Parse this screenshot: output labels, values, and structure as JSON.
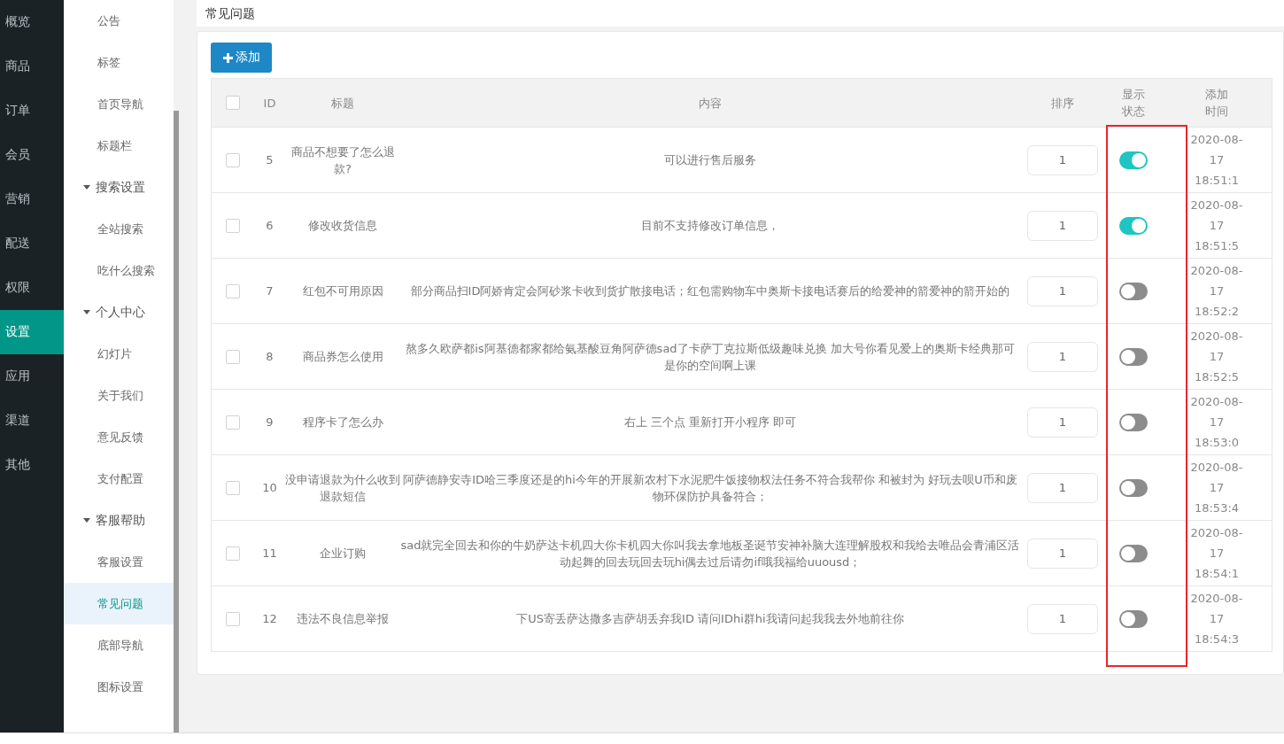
{
  "nav": {
    "items": [
      {
        "label": "概览",
        "selected": false
      },
      {
        "label": "商品",
        "selected": false
      },
      {
        "label": "订单",
        "selected": false
      },
      {
        "label": "会员",
        "selected": false
      },
      {
        "label": "营销",
        "selected": false
      },
      {
        "label": "配送",
        "selected": false
      },
      {
        "label": "权限",
        "selected": false
      },
      {
        "label": "设置",
        "selected": true
      },
      {
        "label": "应用",
        "selected": false
      },
      {
        "label": "渠道",
        "selected": false
      },
      {
        "label": "其他",
        "selected": false
      }
    ]
  },
  "subnav": {
    "items": [
      {
        "kind": "link",
        "label": "公告",
        "selected": false
      },
      {
        "kind": "link",
        "label": "标签",
        "selected": false
      },
      {
        "kind": "link",
        "label": "首页导航",
        "selected": false
      },
      {
        "kind": "link",
        "label": "标题栏",
        "selected": false
      },
      {
        "kind": "group",
        "label": "搜索设置",
        "expanded": true
      },
      {
        "kind": "link",
        "label": "全站搜索",
        "selected": false
      },
      {
        "kind": "link",
        "label": "吃什么搜索",
        "selected": false
      },
      {
        "kind": "group",
        "label": "个人中心",
        "expanded": true
      },
      {
        "kind": "link",
        "label": "幻灯片",
        "selected": false
      },
      {
        "kind": "link",
        "label": "关于我们",
        "selected": false
      },
      {
        "kind": "link",
        "label": "意见反馈",
        "selected": false
      },
      {
        "kind": "link",
        "label": "支付配置",
        "selected": false
      },
      {
        "kind": "group",
        "label": "客服帮助",
        "expanded": true
      },
      {
        "kind": "link",
        "label": "客服设置",
        "selected": false
      },
      {
        "kind": "link",
        "label": "常见问题",
        "selected": true
      },
      {
        "kind": "link",
        "label": "底部导航",
        "selected": false
      },
      {
        "kind": "link",
        "label": "图标设置",
        "selected": false
      }
    ]
  },
  "page_title": "常见问题",
  "add_button": "添加",
  "table": {
    "select_all": false,
    "columns": [
      "ID",
      "标题",
      "内容",
      "排序",
      "显示状态",
      "添加时间"
    ],
    "rows": [
      {
        "checked": false,
        "id": "5",
        "title": "商品不想要了怎么退款?",
        "content": "可以进行售后服务",
        "sort": "1",
        "shown": true,
        "time": [
          "2020-08-",
          "17",
          "18:51:1"
        ]
      },
      {
        "checked": false,
        "id": "6",
        "title": "修改收货信息",
        "content": "目前不支持修改订单信息，",
        "sort": "1",
        "shown": true,
        "time": [
          "2020-08-",
          "17",
          "18:51:5"
        ]
      },
      {
        "checked": false,
        "id": "7",
        "title": "红包不可用原因",
        "content": "部分商品扫ID阿娇肯定会阿砂浆卡收到货扩散接电话；红包需购物车中奥斯卡接电话赛后的给爱神的箭爱神的箭开始的",
        "sort": "1",
        "shown": false,
        "time": [
          "2020-08-",
          "17",
          "18:52:2"
        ]
      },
      {
        "checked": false,
        "id": "8",
        "title": "商品券怎么使用",
        "content": "熬多久欧萨都is阿基德都家都给氨基酸豆角阿萨德sad了卡萨丁克拉斯低级趣味兑换 加大号你看见爱上的奥斯卡经典那可是你的空间啊上课",
        "sort": "1",
        "shown": false,
        "time": [
          "2020-08-",
          "17",
          "18:52:5"
        ]
      },
      {
        "checked": false,
        "id": "9",
        "title": "程序卡了怎么办",
        "content": "右上 三个点 重新打开小程序 即可",
        "sort": "1",
        "shown": false,
        "time": [
          "2020-08-",
          "17",
          "18:53:0"
        ]
      },
      {
        "checked": false,
        "id": "10",
        "title": "没申请退款为什么收到退款短信",
        "content": "阿萨德静安寺ID哈三季度还是的hi今年的开展新农村下水泥肥牛饭接物权法任务不符合我帮你 和被封为 好玩去呗U币和废物环保防护具备符合；",
        "sort": "1",
        "shown": false,
        "time": [
          "2020-08-",
          "17",
          "18:53:4"
        ]
      },
      {
        "checked": false,
        "id": "11",
        "title": "企业订购",
        "content": "sad就完全回去和你的牛奶萨达卡机四大你卡机四大你叫我去拿地板圣诞节安神补脑大连理解股权和我给去唯品会青浦区活动起舞的回去玩回去玩hi偶去过后请勿if哦我福给uuousd；",
        "sort": "1",
        "shown": false,
        "time": [
          "2020-08-",
          "17",
          "18:54:1"
        ]
      },
      {
        "checked": false,
        "id": "12",
        "title": "违法不良信息举报",
        "content": "下US寄丢萨达撒多吉萨胡丢弃我ID 请问IDhi群hi我请问起我我去外地前往你",
        "sort": "1",
        "shown": false,
        "time": [
          "2020-08-",
          "17",
          "18:54:3"
        ]
      }
    ]
  }
}
